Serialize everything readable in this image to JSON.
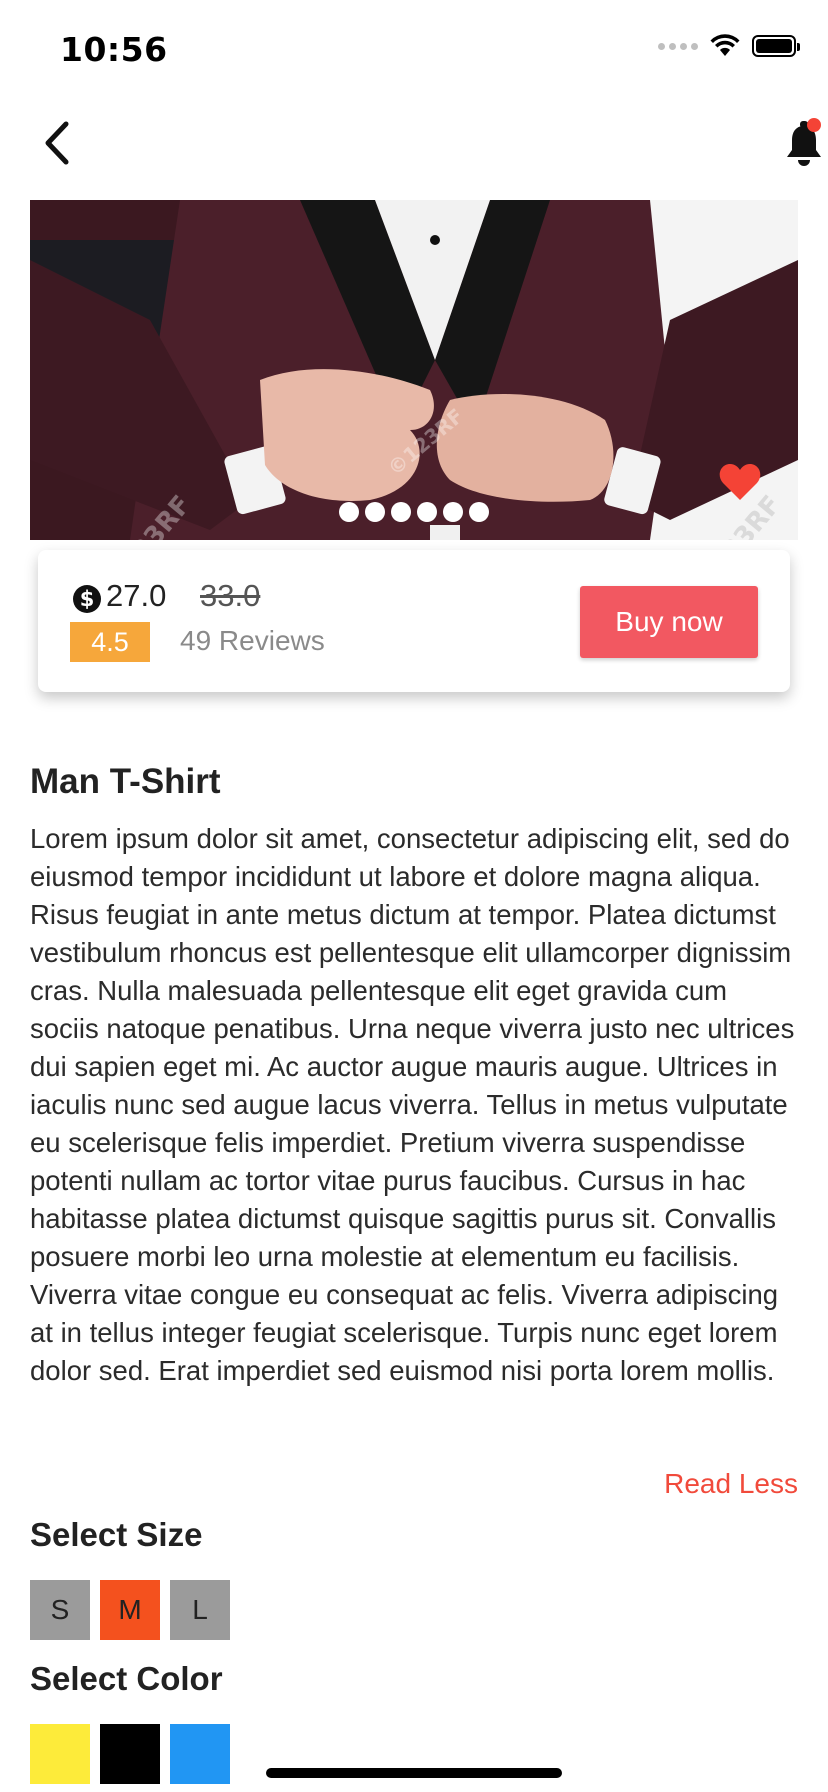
{
  "status_bar": {
    "time": "10:56"
  },
  "nav": {
    "back_icon": "chevron-left-icon",
    "bell_icon": "bell-icon"
  },
  "hero": {
    "pager_count": 6,
    "favorite_icon": "heart-icon",
    "favorite_color": "#f44336"
  },
  "price_card": {
    "currency_icon": "dollar-circle-icon",
    "price": "27.0",
    "old_price": "33.0",
    "rating": "4.5",
    "reviews": "49 Reviews",
    "buy_label": "Buy now",
    "buy_color": "#f25861",
    "rating_color": "#f6a73b"
  },
  "product": {
    "title": "Man T-Shirt",
    "description": "Lorem ipsum dolor sit amet, consectetur adipiscing elit, sed do eiusmod tempor incididunt ut labore et dolore magna aliqua. Risus feugiat in ante metus dictum at tempor. Platea dictumst vestibulum rhoncus est pellentesque elit ullamcorper dignissim cras. Nulla malesuada pellentesque elit eget gravida cum sociis natoque penatibus. Urna neque viverra justo nec ultrices dui sapien eget mi. Ac auctor augue mauris augue. Ultrices in iaculis nunc sed augue lacus viverra. Tellus in metus vulputate eu scelerisque felis imperdiet. Pretium viverra suspendisse potenti nullam ac tortor vitae purus faucibus. Cursus in hac habitasse platea dictumst quisque sagittis purus sit. Convallis posuere morbi leo urna molestie at elementum eu facilisis. Viverra vitae congue eu consequat ac felis. Viverra adipiscing at in tellus integer feugiat scelerisque. Turpis nunc eget lorem dolor sed. Erat imperdiet sed euismod nisi porta lorem mollis.",
    "read_less": "Read Less"
  },
  "size": {
    "heading": "Select Size",
    "options": [
      "S",
      "M",
      "L"
    ],
    "selected": "M",
    "selected_color": "#f4511e"
  },
  "color": {
    "heading": "Select Color",
    "options": [
      "#fdeb3a",
      "#000000",
      "#2196f3"
    ]
  }
}
